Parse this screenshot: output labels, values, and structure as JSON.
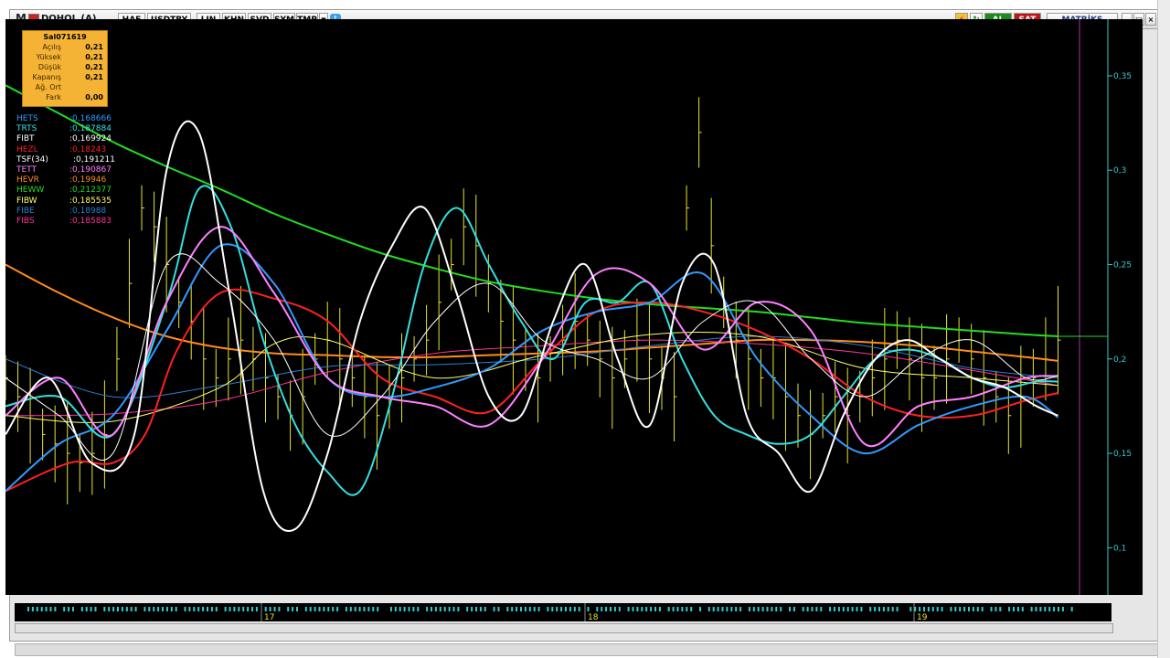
{
  "toolbar": {
    "logo": "M",
    "symbol": "DOHOL (A)",
    "buttons": [
      "HAF",
      "USDTRY",
      "LIN",
      "KHN",
      "SVD",
      "SYM",
      "TMP"
    ],
    "al_label": "AL",
    "sat_label": "SAT",
    "brand": "MATRİKS"
  },
  "infobox": {
    "title": "Sal071619",
    "rows": [
      {
        "k": "Açılış",
        "v": "0,21"
      },
      {
        "k": "Yüksek",
        "v": "0,21"
      },
      {
        "k": "Düşük",
        "v": "0,21"
      },
      {
        "k": "Kapanış",
        "v": "0,21"
      },
      {
        "k": "Ağ. Ort",
        "v": ""
      },
      {
        "k": "Fark",
        "v": "0,00"
      }
    ]
  },
  "legend": [
    {
      "name": "HETS",
      "value": ":0,168666",
      "color": "#3399ff"
    },
    {
      "name": "TRTS",
      "value": ":0,187884",
      "color": "#33e0e0"
    },
    {
      "name": "FIBT",
      "value": ":0,169924",
      "color": "#ffffff"
    },
    {
      "name": "HEZL",
      "value": ":0,18243",
      "color": "#ff2020"
    },
    {
      "name": "TSF(34)",
      "value": ":0,191211",
      "color": "#ffffff"
    },
    {
      "name": "TETT",
      "value": ":0,190867",
      "color": "#ff80ff"
    },
    {
      "name": "HEVR",
      "value": ":0,19946",
      "color": "#ff8c1a"
    },
    {
      "name": "HEWW",
      "value": ":0,212377",
      "color": "#22dd22"
    },
    {
      "name": "FIBW",
      "value": ":0,185535",
      "color": "#ffff66"
    },
    {
      "name": "FIBE",
      "value": ":0,18988",
      "color": "#2a7fd4"
    },
    {
      "name": "FIBS",
      "value": ":0,185883",
      "color": "#ff3399"
    }
  ],
  "chart_data": {
    "type": "line",
    "title": "DOHOL (A)",
    "xlabel": "",
    "ylabel": "",
    "ylim": [
      0.075,
      0.38
    ],
    "yticks": [
      "0,35",
      "0,3",
      "0,25",
      "0,2",
      "0,15",
      "0,1"
    ],
    "ytick_values": [
      0.35,
      0.3,
      0.25,
      0.2,
      0.15,
      0.1
    ],
    "xticks": [
      "17",
      "18",
      "19"
    ],
    "xtick_positions": [
      0.225,
      0.52,
      0.82
    ],
    "series": [
      {
        "name": "HEWW",
        "color": "#22dd22",
        "x": [
          0,
          0.05,
          0.1,
          0.15,
          0.2,
          0.25,
          0.3,
          0.35,
          0.4,
          0.45,
          0.5,
          0.55,
          0.6,
          0.65,
          0.7,
          0.75,
          0.8,
          0.85,
          0.9,
          0.95,
          0.98
        ],
        "values": [
          0.345,
          0.33,
          0.315,
          0.302,
          0.29,
          0.277,
          0.266,
          0.256,
          0.248,
          0.241,
          0.236,
          0.232,
          0.229,
          0.227,
          0.225,
          0.222,
          0.219,
          0.217,
          0.215,
          0.213,
          0.212
        ]
      },
      {
        "name": "HEVR",
        "color": "#ff8c1a",
        "x": [
          0,
          0.05,
          0.1,
          0.15,
          0.2,
          0.25,
          0.3,
          0.35,
          0.4,
          0.45,
          0.5,
          0.55,
          0.6,
          0.65,
          0.7,
          0.75,
          0.8,
          0.85,
          0.9,
          0.95,
          0.98
        ],
        "values": [
          0.25,
          0.235,
          0.222,
          0.212,
          0.206,
          0.203,
          0.202,
          0.201,
          0.201,
          0.202,
          0.203,
          0.204,
          0.206,
          0.208,
          0.21,
          0.21,
          0.209,
          0.207,
          0.204,
          0.201,
          0.199
        ]
      },
      {
        "name": "FIBS",
        "color": "#ff3399",
        "x": [
          0,
          0.1,
          0.2,
          0.3,
          0.4,
          0.5,
          0.6,
          0.7,
          0.8,
          0.9,
          0.98
        ],
        "values": [
          0.17,
          0.171,
          0.178,
          0.193,
          0.203,
          0.207,
          0.21,
          0.208,
          0.203,
          0.194,
          0.186
        ]
      },
      {
        "name": "FIBE",
        "color": "#2a7fd4",
        "x": [
          0,
          0.1,
          0.2,
          0.3,
          0.4,
          0.5,
          0.6,
          0.7,
          0.8,
          0.9,
          0.98
        ],
        "values": [
          0.2,
          0.18,
          0.186,
          0.196,
          0.197,
          0.2,
          0.207,
          0.212,
          0.207,
          0.195,
          0.19
        ]
      },
      {
        "name": "FIBW",
        "color": "#ffff66",
        "x": [
          0,
          0.1,
          0.2,
          0.25,
          0.3,
          0.4,
          0.5,
          0.6,
          0.7,
          0.8,
          0.9,
          0.98
        ],
        "values": [
          0.17,
          0.167,
          0.185,
          0.208,
          0.21,
          0.19,
          0.202,
          0.213,
          0.212,
          0.195,
          0.19,
          0.186
        ]
      },
      {
        "name": "HEZL",
        "color": "#ff2020",
        "x": [
          0,
          0.06,
          0.1,
          0.13,
          0.16,
          0.2,
          0.25,
          0.3,
          0.35,
          0.4,
          0.45,
          0.5,
          0.55,
          0.6,
          0.65,
          0.7,
          0.75,
          0.8,
          0.85,
          0.9,
          0.95,
          0.98
        ],
        "values": [
          0.13,
          0.145,
          0.145,
          0.16,
          0.205,
          0.235,
          0.232,
          0.22,
          0.19,
          0.18,
          0.172,
          0.2,
          0.225,
          0.23,
          0.225,
          0.215,
          0.2,
          0.18,
          0.17,
          0.17,
          0.178,
          0.182
        ]
      },
      {
        "name": "HETS",
        "color": "#3399ff",
        "x": [
          0,
          0.05,
          0.1,
          0.15,
          0.2,
          0.25,
          0.3,
          0.35,
          0.4,
          0.45,
          0.5,
          0.55,
          0.6,
          0.65,
          0.7,
          0.75,
          0.8,
          0.85,
          0.9,
          0.95,
          0.98
        ],
        "values": [
          0.13,
          0.155,
          0.17,
          0.215,
          0.26,
          0.24,
          0.19,
          0.18,
          0.185,
          0.195,
          0.215,
          0.225,
          0.23,
          0.245,
          0.2,
          0.17,
          0.15,
          0.165,
          0.175,
          0.18,
          0.169
        ]
      },
      {
        "name": "TRTS",
        "color": "#33e0e0",
        "x": [
          0,
          0.05,
          0.1,
          0.15,
          0.18,
          0.21,
          0.24,
          0.27,
          0.3,
          0.33,
          0.36,
          0.39,
          0.42,
          0.45,
          0.48,
          0.51,
          0.54,
          0.57,
          0.6,
          0.63,
          0.66,
          0.69,
          0.72,
          0.75,
          0.78,
          0.81,
          0.84,
          0.87,
          0.9,
          0.93,
          0.96,
          0.98
        ],
        "values": [
          0.175,
          0.18,
          0.16,
          0.23,
          0.29,
          0.27,
          0.21,
          0.165,
          0.14,
          0.13,
          0.18,
          0.25,
          0.28,
          0.25,
          0.22,
          0.2,
          0.23,
          0.23,
          0.24,
          0.2,
          0.17,
          0.16,
          0.155,
          0.16,
          0.18,
          0.2,
          0.205,
          0.2,
          0.19,
          0.185,
          0.188,
          0.188
        ]
      },
      {
        "name": "TETT",
        "color": "#ff80ff",
        "x": [
          0,
          0.05,
          0.1,
          0.15,
          0.2,
          0.25,
          0.3,
          0.35,
          0.4,
          0.45,
          0.5,
          0.55,
          0.6,
          0.65,
          0.7,
          0.75,
          0.8,
          0.85,
          0.9,
          0.95,
          0.98
        ],
        "values": [
          0.17,
          0.19,
          0.16,
          0.23,
          0.27,
          0.235,
          0.19,
          0.18,
          0.175,
          0.165,
          0.2,
          0.245,
          0.24,
          0.205,
          0.23,
          0.215,
          0.155,
          0.175,
          0.18,
          0.19,
          0.191
        ]
      },
      {
        "name": "FIBT",
        "color": "#ffffff",
        "x": [
          0,
          0.04,
          0.08,
          0.12,
          0.15,
          0.18,
          0.21,
          0.24,
          0.27,
          0.3,
          0.33,
          0.36,
          0.39,
          0.42,
          0.45,
          0.48,
          0.51,
          0.54,
          0.57,
          0.6,
          0.63,
          0.66,
          0.69,
          0.72,
          0.75,
          0.78,
          0.81,
          0.84,
          0.87,
          0.9,
          0.93,
          0.96,
          0.98
        ],
        "values": [
          0.16,
          0.19,
          0.145,
          0.16,
          0.3,
          0.32,
          0.23,
          0.13,
          0.11,
          0.15,
          0.22,
          0.26,
          0.28,
          0.235,
          0.18,
          0.17,
          0.22,
          0.25,
          0.2,
          0.165,
          0.24,
          0.25,
          0.17,
          0.15,
          0.13,
          0.17,
          0.2,
          0.21,
          0.2,
          0.19,
          0.185,
          0.175,
          0.17
        ]
      },
      {
        "name": "TSF(34)",
        "color": "#ffffff",
        "x": [
          0,
          0.05,
          0.1,
          0.15,
          0.2,
          0.25,
          0.3,
          0.35,
          0.4,
          0.45,
          0.5,
          0.55,
          0.6,
          0.65,
          0.7,
          0.75,
          0.8,
          0.85,
          0.9,
          0.95,
          0.98
        ],
        "values": [
          0.19,
          0.17,
          0.15,
          0.25,
          0.24,
          0.21,
          0.16,
          0.18,
          0.22,
          0.24,
          0.21,
          0.2,
          0.19,
          0.22,
          0.23,
          0.2,
          0.18,
          0.2,
          0.21,
          0.19,
          0.191
        ]
      }
    ],
    "price_bars_note": "yellow OHLC bars",
    "prices": {
      "x_start": 0.0,
      "x_end": 0.98,
      "values": [
        0.19,
        0.18,
        0.17,
        0.16,
        0.155,
        0.15,
        0.145,
        0.15,
        0.16,
        0.2,
        0.24,
        0.28,
        0.27,
        0.25,
        0.23,
        0.22,
        0.2,
        0.19,
        0.2,
        0.21,
        0.2,
        0.19,
        0.18,
        0.17,
        0.18,
        0.2,
        0.21,
        0.2,
        0.19,
        0.18,
        0.17,
        0.18,
        0.19,
        0.2,
        0.21,
        0.23,
        0.25,
        0.27,
        0.26,
        0.24,
        0.22,
        0.21,
        0.2,
        0.19,
        0.2,
        0.21,
        0.22,
        0.21,
        0.2,
        0.19,
        0.2,
        0.21,
        0.2,
        0.19,
        0.18,
        0.28,
        0.32,
        0.26,
        0.23,
        0.21,
        0.2,
        0.19,
        0.19,
        0.18,
        0.17,
        0.16,
        0.17,
        0.18,
        0.17,
        0.18,
        0.19,
        0.2,
        0.21,
        0.2,
        0.19,
        0.19,
        0.2,
        0.21,
        0.2,
        0.19,
        0.18,
        0.17,
        0.18,
        0.19,
        0.2,
        0.21
      ]
    }
  },
  "xaxis_labels": [
    "17",
    "18",
    "19"
  ]
}
